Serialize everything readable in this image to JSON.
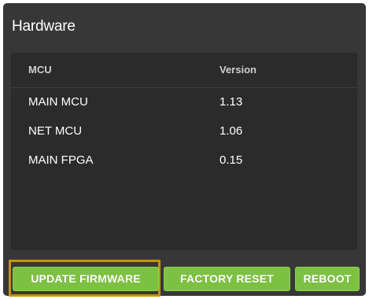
{
  "panel": {
    "title": "Hardware"
  },
  "table": {
    "headers": {
      "mcu": "MCU",
      "version": "Version"
    },
    "rows": [
      {
        "mcu": "MAIN MCU",
        "version": "1.13"
      },
      {
        "mcu": "NET MCU",
        "version": "1.06"
      },
      {
        "mcu": "MAIN FPGA",
        "version": "0.15"
      }
    ]
  },
  "actions": {
    "update_firmware_label": "UPDATE FIRMWARE",
    "factory_reset_label": "FACTORY RESET",
    "reboot_label": "REBOOT",
    "focused": "update_firmware"
  },
  "colors": {
    "panel_background": "#373737",
    "table_background": "#2b2b2b",
    "button_green": "#7dc142",
    "focus_outline": "#c6930a"
  }
}
